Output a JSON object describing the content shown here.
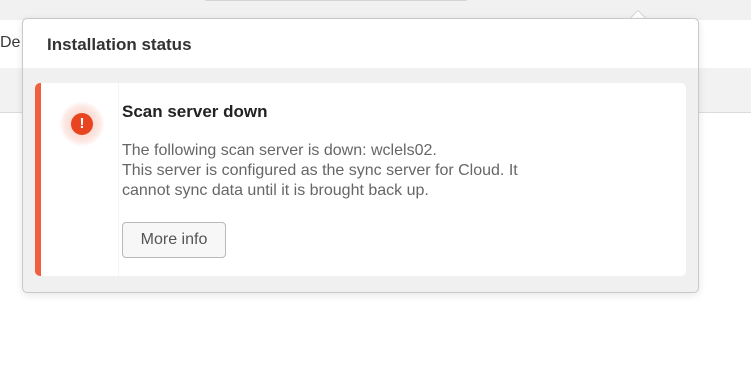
{
  "background": {
    "tab_fragment": "De"
  },
  "popover": {
    "title": "Installation status",
    "alert": {
      "severity_icon": "exclamation-icon",
      "accent_color": "#f06040",
      "title": "Scan server down",
      "body_lines": [
        "The following scan server is down: wclels02.",
        "This server is configured as the sync server for Cloud. It",
        "cannot sync data until it is brought back up."
      ],
      "more_info_label": "More info"
    }
  }
}
